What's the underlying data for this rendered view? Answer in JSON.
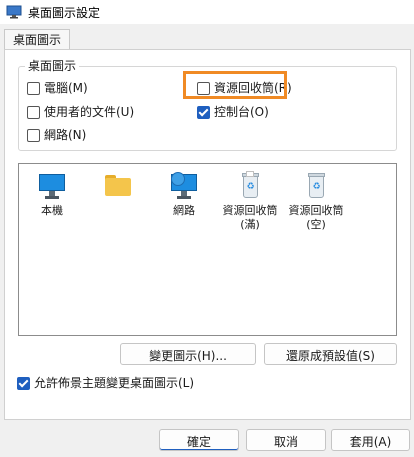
{
  "window": {
    "title": "桌面圖示設定",
    "icon": "desktop-settings-icon"
  },
  "tabs": [
    {
      "label": "桌面圖示"
    }
  ],
  "desktop_icons_group": {
    "legend": "桌面圖示",
    "checkboxes": [
      {
        "label": "電腦(M)",
        "checked": false
      },
      {
        "label": "資源回收筒(R)",
        "checked": false
      },
      {
        "label": "使用者的文件(U)",
        "checked": false
      },
      {
        "label": "控制台(O)",
        "checked": true
      },
      {
        "label": "網路(N)",
        "checked": false
      }
    ]
  },
  "icon_list": [
    {
      "label": "本機",
      "icon": "monitor-icon"
    },
    {
      "label": "",
      "icon": "folder-icon"
    },
    {
      "label": "網路",
      "icon": "network-icon"
    },
    {
      "label": "資源回收筒 (滿)",
      "icon": "recycle-bin-full-icon"
    },
    {
      "label": "資源回收筒 (空)",
      "icon": "recycle-bin-empty-icon"
    }
  ],
  "buttons": {
    "change_icon": "變更圖示(H)...",
    "restore_default": "還原成預設值(S)",
    "ok": "確定",
    "cancel": "取消",
    "apply": "套用(A)"
  },
  "allow_themes": {
    "label": "允許佈景主題變更桌面圖示(L)",
    "checked": true
  },
  "colors": {
    "accent": "#1f5fbf",
    "highlight": "#f08a24"
  }
}
